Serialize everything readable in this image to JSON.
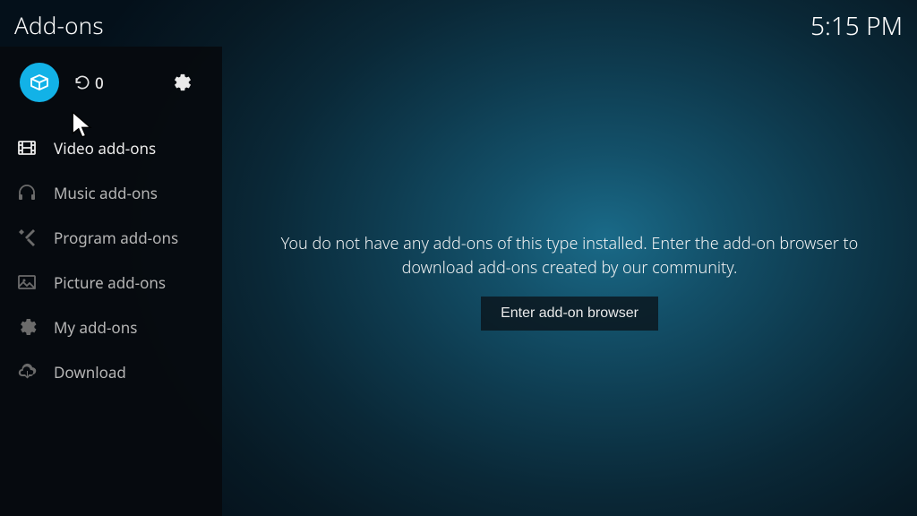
{
  "header": {
    "title": "Add-ons",
    "clock": "5:15 PM"
  },
  "toolbar": {
    "update_count": "0"
  },
  "sidebar": {
    "items": [
      {
        "label": "Video add-ons"
      },
      {
        "label": "Music add-ons"
      },
      {
        "label": "Program add-ons"
      },
      {
        "label": "Picture add-ons"
      },
      {
        "label": "My add-ons"
      },
      {
        "label": "Download"
      }
    ]
  },
  "main": {
    "empty_message": "You do not have any add-ons of this type installed. Enter the add-on browser to download add-ons created by our community.",
    "enter_button": "Enter add-on browser"
  }
}
